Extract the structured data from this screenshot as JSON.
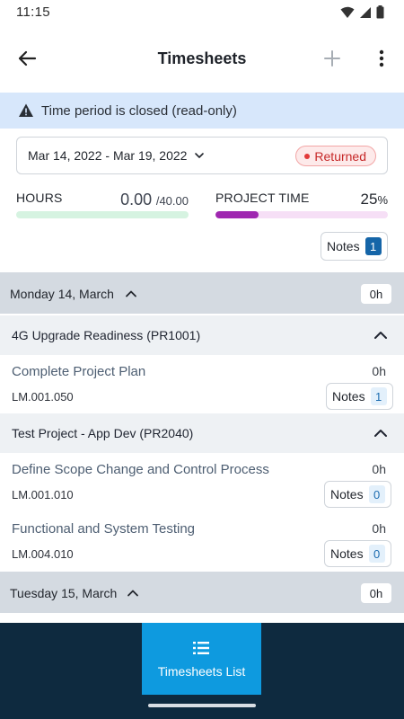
{
  "status_bar": {
    "time": "11:15"
  },
  "app_bar": {
    "title": "Timesheets"
  },
  "banner": {
    "text": "Time period is closed (read-only)"
  },
  "period": {
    "range": "Mar 14, 2022 - Mar 19, 2022",
    "status": "Returned"
  },
  "hours": {
    "label": "HOURS",
    "value": "0.00",
    "total": "/40.00",
    "progress": 0
  },
  "project_time": {
    "label": "PROJECT TIME",
    "value": "25",
    "unit": "%",
    "progress": 0.25
  },
  "notes_summary": {
    "label": "Notes",
    "count": "1"
  },
  "days": [
    {
      "label": "Monday 14, March",
      "hours": "0h",
      "projects": [
        {
          "name": "4G Upgrade Readiness (PR1001)",
          "tasks": [
            {
              "name": "Complete Project Plan",
              "hours": "0h",
              "code": "LM.001.050",
              "notes_label": "Notes",
              "notes_count": "1"
            }
          ]
        },
        {
          "name": "Test Project - App Dev (PR2040)",
          "tasks": [
            {
              "name": "Define Scope Change and Control Process",
              "hours": "0h",
              "code": "LM.001.010",
              "notes_label": "Notes",
              "notes_count": "0"
            },
            {
              "name": "Functional and System Testing",
              "hours": "0h",
              "code": "LM.004.010",
              "notes_label": "Notes",
              "notes_count": "0"
            }
          ]
        }
      ]
    },
    {
      "label": "Tuesday 15, March",
      "hours": "0h"
    }
  ],
  "bottom_nav": {
    "tab_label": "Timesheets List"
  },
  "colors": {
    "banner_bg": "#d7e7fb",
    "returned_red": "#c62828",
    "hours_green": "#3bbd72",
    "project_purple": "#9f27b0",
    "nav_bg": "#0e2a3f",
    "nav_active": "#0e9adf"
  },
  "icons": {
    "back": "arrow-left-icon",
    "add": "plus-icon",
    "more": "more-vertical-icon",
    "warning": "warning-icon",
    "dropdown": "chevron-down-icon",
    "collapse": "chevron-up-icon",
    "list": "list-icon"
  }
}
